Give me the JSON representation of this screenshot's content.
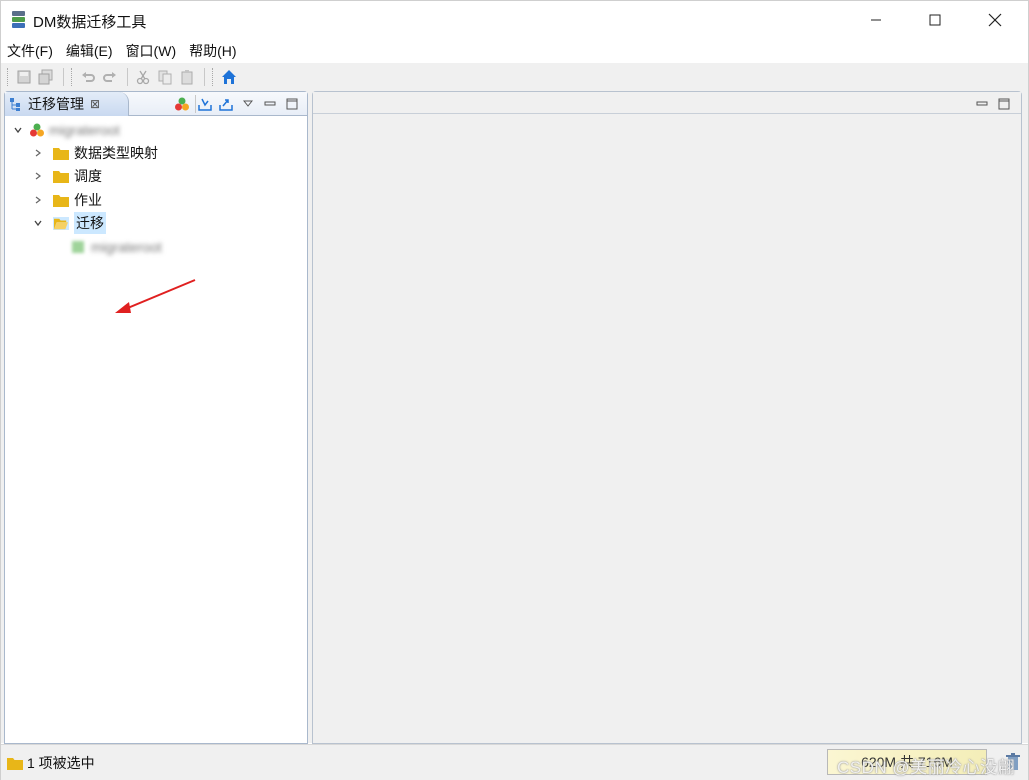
{
  "app": {
    "title": "DM数据迁移工具",
    "accent_color": "#1e73d8"
  },
  "window_controls": {
    "minimize_icon": "minimize-icon",
    "maximize_icon": "maximize-icon",
    "close_icon": "close-icon"
  },
  "menu": {
    "items": [
      {
        "label": "文件(F)"
      },
      {
        "label": "编辑(E)"
      },
      {
        "label": "窗口(W)"
      },
      {
        "label": "帮助(H)"
      }
    ]
  },
  "toolbar": {
    "buttons": [
      "save-icon",
      "save-all-icon",
      "undo-icon",
      "redo-icon",
      "cut-icon",
      "copy-icon",
      "paste-icon",
      "home-icon"
    ]
  },
  "left_view": {
    "tab_label": "迁移管理",
    "tab_close": "⊠",
    "actions": [
      "new-project-icon",
      "import-icon",
      "export-icon",
      "view-menu-icon",
      "minimize-view-icon",
      "maximize-view-icon"
    ]
  },
  "tree": {
    "root_label": "migrateroot",
    "nodes": [
      {
        "label": "数据类型映射",
        "expanded": false
      },
      {
        "label": "调度",
        "expanded": false
      },
      {
        "label": "作业",
        "expanded": false
      },
      {
        "label": "迁移",
        "expanded": true,
        "selected": true
      }
    ],
    "child_label": "migrateroot"
  },
  "status": {
    "selection_text": "1 项被选中",
    "heap_text": "620M 共 716M"
  },
  "watermark": "CSDN @美丽冷心没翩"
}
